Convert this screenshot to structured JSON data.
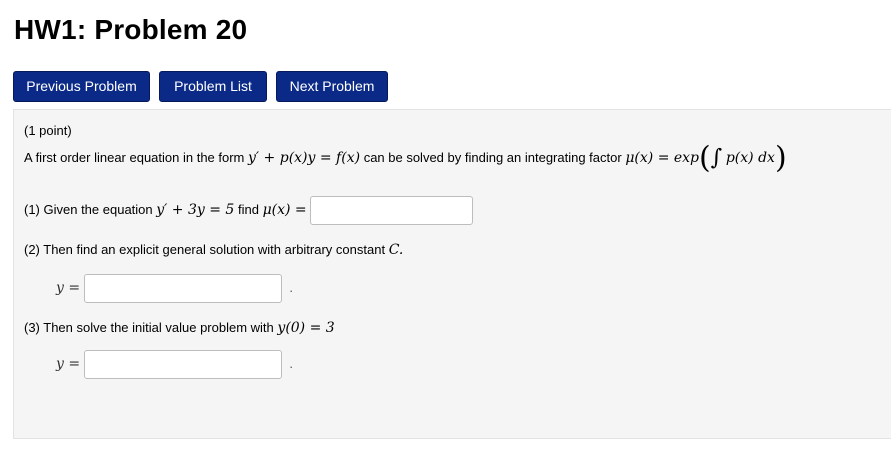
{
  "page": {
    "title": "HW1: Problem 20"
  },
  "nav": {
    "prev_label": "Previous Problem",
    "list_label": "Problem List",
    "next_label": "Next Problem"
  },
  "problem": {
    "points": "(1 point)",
    "intro_prefix": "A first order linear equation in the form",
    "intro_eq_form": "y′ + p(x)y = f(x)",
    "intro_mid": "can be solved by finding an integrating factor",
    "intro_mu": "μ(x) = exp",
    "intro_integrand": "p(x) dx",
    "q1_prefix": "(1) Given the equation",
    "q1_eq": "y′ + 3y = 5",
    "q1_find": "find",
    "q1_mu": "μ(x) =",
    "q2_text": "(2) Then find an explicit general solution with arbitrary constant",
    "q2_const": "C.",
    "q3_prefix": "(3) Then solve the initial value problem with",
    "q3_cond": "y(0) = 3",
    "answer_label": "y =",
    "period": "."
  },
  "inputs": {
    "mu_value": "",
    "general_solution_value": "",
    "ivp_solution_value": ""
  }
}
